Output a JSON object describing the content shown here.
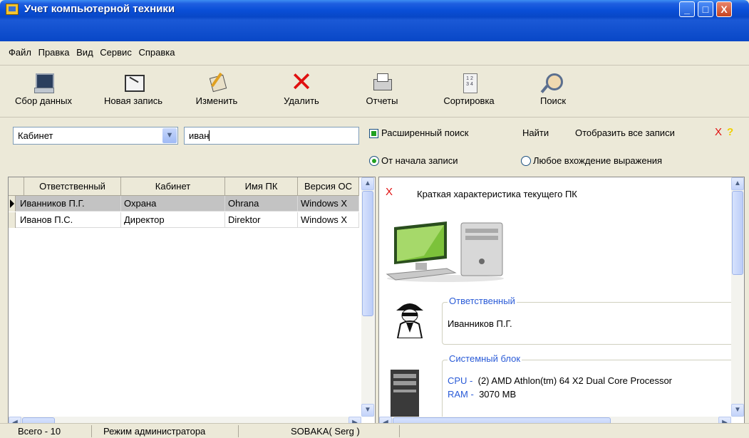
{
  "window": {
    "title": "Учет компьютерной техники",
    "minimize_glyph": "_",
    "maximize_glyph": "□",
    "close_glyph": "X"
  },
  "menu": [
    "Файл",
    "Правка",
    "Вид",
    "Сервис",
    "Справка"
  ],
  "toolbar": {
    "collect": "Сбор данных",
    "new_record": "Новая запись",
    "edit": "Изменить",
    "delete": "Удалить",
    "reports": "Отчеты",
    "sort": "Сортировка",
    "search": "Поиск"
  },
  "search": {
    "field_selected": "Кабинет",
    "query": "иван",
    "advanced_search_label": "Расширенный поиск",
    "advanced_search_checked": true,
    "find_label": "Найти",
    "show_all_label": "Отобразить все записи",
    "clear_glyph": "X",
    "help_glyph": "?",
    "mode_from_start": "От начала записи",
    "mode_any": "Любое вхождение выражения",
    "selected_mode": "from_start"
  },
  "grid": {
    "columns": [
      "Ответственный",
      "Кабинет",
      "Имя ПК",
      "Версия ОС"
    ],
    "rows": [
      [
        "Иванников П.Г.",
        "Охрана",
        "Ohrana",
        "Windows X"
      ],
      [
        "Иванов П.С.",
        "Директор",
        "Direktor",
        "Windows X"
      ]
    ],
    "selected_row": 0
  },
  "details": {
    "close_glyph": "X",
    "title": "Краткая характеристика текущего ПК",
    "responsible_caption": "Ответственный",
    "responsible_value": "Иванников П.Г.",
    "system_unit_caption": "Системный блок",
    "cpu_label": "CPU -",
    "cpu_value": "(2) AMD Athlon(tm) 64 X2 Dual Core Processor",
    "ram_label": "RAM -",
    "ram_value": "3070 MB"
  },
  "status": {
    "total": "Всего - 10",
    "mode": "Режим администратора",
    "user": "SOBAKA( Serg )"
  },
  "colors": {
    "title_bar": "#0a4fd8",
    "accent_blue": "#2a5bd7",
    "delete_red": "#e01010"
  }
}
